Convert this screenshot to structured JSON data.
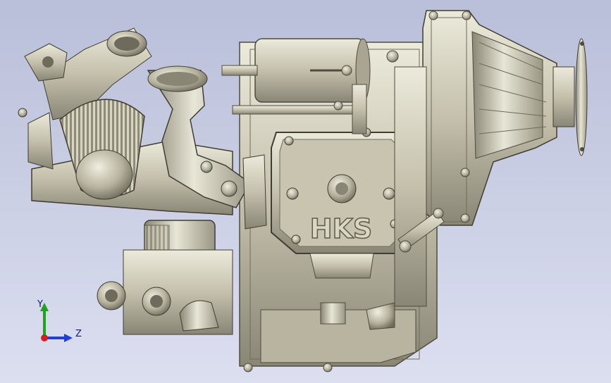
{
  "viewport": {
    "background_top": "#b9bfd9",
    "background_bottom": "#dcdff0"
  },
  "model": {
    "emboss_text": "HKS",
    "metal_light": "#e4e2d2",
    "metal_mid": "#b9b5a1",
    "metal_dark": "#6f6b5c"
  },
  "triad": {
    "y_label": "Y",
    "z_label": "Z",
    "y_color": "#1fa31f",
    "z_color": "#1f3fd6",
    "x_color": "#d21f1f"
  }
}
